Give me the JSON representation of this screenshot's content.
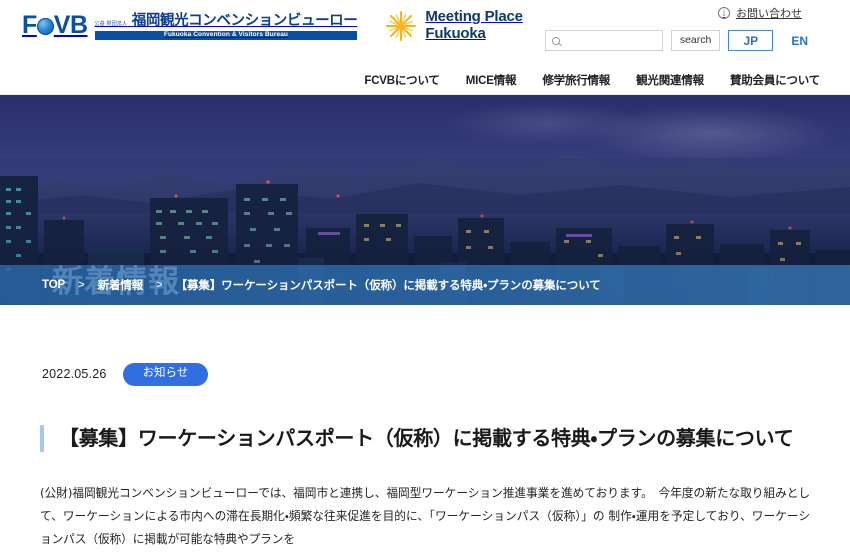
{
  "header": {
    "fcvb_logo": {
      "mark_f": "F",
      "mark_cvb": "VB",
      "jp_prefix": "公益 財団法人",
      "jp_name": "福岡観光コンベンションビューロー",
      "en_bar": "Fukuoka Convention & Visitors Bureau"
    },
    "mpf_logo": {
      "line1": "Meeting Place",
      "line2": "Fukuoka",
      "star_color": "#f5b614"
    },
    "contact": {
      "icon": "info-circle-icon",
      "label": "お問い合わせ"
    },
    "search": {
      "icon": "search-icon",
      "value": "",
      "placeholder": "",
      "button_label": "search"
    },
    "language": {
      "jp_label": "JP",
      "en_label": "EN",
      "active": "JP",
      "accent": "#2f6fc4"
    },
    "nav": [
      {
        "label": "FCVBについて"
      },
      {
        "label": "MICE情報"
      },
      {
        "label": "修学旅行情報"
      },
      {
        "label": "観光関連情報"
      },
      {
        "label": "賛助会員について"
      }
    ]
  },
  "hero": {
    "title": "新着情報",
    "image_description": "福岡夜景"
  },
  "breadcrumb": {
    "separator": "＞",
    "items": [
      {
        "label": "TOP"
      },
      {
        "label": "新着情報"
      },
      {
        "label": "【募集】ワーケーションパスポート（仮称）に掲載する特典・プランの募集について"
      }
    ]
  },
  "article": {
    "date": "2022.05.26",
    "badge": "お知らせ",
    "badge_color": "#2f6fe0",
    "accent_color": "#a9c7ea",
    "title": "【募集】ワーケーションパスポート（仮称）に掲載する特典・プランの募集について",
    "body": "(公財)福岡観光コンベンションビューローでは、福岡市と連携し、福岡型ワーケーション推進事業を進めております。　今年度の新たな取り組みとして、ワーケーションによる市内への滞在長期化・頻繁な往来促進を目的に、「ワーケーションパス（仮称）」の 制作・運用を予定しており、ワーケーションパス（仮称）に掲載が可能な特典やプランを"
  }
}
